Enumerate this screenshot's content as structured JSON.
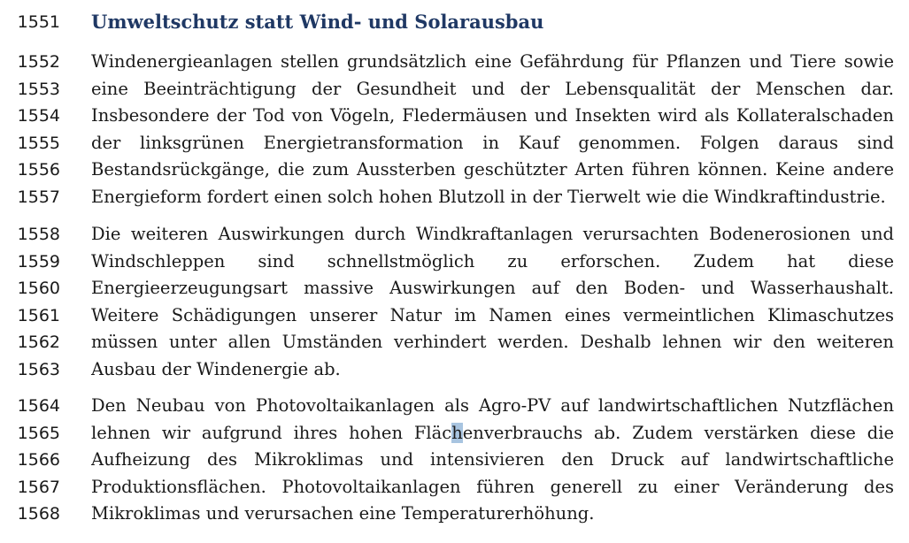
{
  "heading": {
    "number": "1551",
    "title": "Umweltschutz statt Wind- und Solarausbau"
  },
  "paragraphs": [
    [
      {
        "number": "1552",
        "text": "Windenergieanlagen stellen grundsätzlich eine Gefährdung für Pflanzen und Tiere sowie"
      },
      {
        "number": "1553",
        "text": "eine Beeinträchtigung der Gesundheit und der Lebensqualität der Menschen dar."
      },
      {
        "number": "1554",
        "text": "Insbesondere der Tod von Vögeln, Fledermäusen und Insekten wird als Kollateralschaden"
      },
      {
        "number": "1555",
        "text": "der linksgrünen Energietransformation in Kauf genommen. Folgen daraus sind"
      },
      {
        "number": "1556",
        "text": "Bestandsrückgänge, die zum Aussterben geschützter Arten führen können. Keine andere"
      },
      {
        "number": "1557",
        "text": "Energieform fordert einen solch hohen Blutzoll in der Tierwelt wie die Windkraftindustrie."
      }
    ],
    [
      {
        "number": "1558",
        "text": "Die weiteren Auswirkungen durch Windkraftanlagen verursachten Bodenerosionen und"
      },
      {
        "number": "1559",
        "text": "Windschleppen sind schnellstmöglich zu erforschen. Zudem hat diese"
      },
      {
        "number": "1560",
        "text": "Energieerzeugungsart massive Auswirkungen auf den Boden- und Wasserhaushalt."
      },
      {
        "number": "1561",
        "text": "Weitere Schädigungen unserer Natur im Namen eines vermeintlichen Klimaschutzes"
      },
      {
        "number": "1562",
        "text": "müssen unter allen Umständen verhindert werden. Deshalb lehnen wir den weiteren"
      },
      {
        "number": "1563",
        "text": "Ausbau der Windenergie ab."
      }
    ],
    [
      {
        "number": "1564",
        "text": "Den Neubau von Photovoltaikanlagen als Agro-PV auf landwirtschaftlichen Nutzflächen"
      },
      {
        "number": "1565",
        "text": "lehnen wir aufgrund ihres hohen Flächenverbrauchs ab. Zudem verstärken diese die"
      },
      {
        "number": "1566",
        "text": "Aufheizung des Mikroklimas und intensivieren den Druck auf landwirtschaftliche"
      },
      {
        "number": "1567",
        "text": "Produktionsflächen. Photovoltaikanlagen führen generell zu einer Veränderung des"
      },
      {
        "number": "1568",
        "text": "Mikroklimas und verursachen eine Temperaturerhöhung."
      }
    ]
  ],
  "colors": {
    "heading": "#1f3864",
    "text": "#1a1a1a",
    "selection_highlight": "#a8c4e0"
  }
}
